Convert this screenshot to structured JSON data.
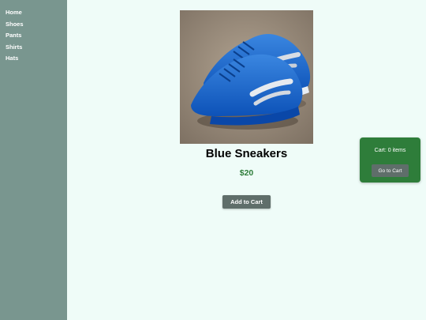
{
  "sidebar": {
    "items": [
      {
        "label": "Home"
      },
      {
        "label": "Shoes"
      },
      {
        "label": "Pants"
      },
      {
        "label": "Shirts"
      },
      {
        "label": "Hats"
      }
    ]
  },
  "product": {
    "title": "Blue Sneakers",
    "price": "$20",
    "add_to_cart_label": "Add to Cart",
    "image_icon": "blue-sneakers-photo"
  },
  "cart": {
    "status": "Cart: 0 items",
    "go_to_cart_label": "Go to Cart"
  },
  "colors": {
    "sidebar_bg": "#79968f",
    "page_bg": "#effcf8",
    "price": "#2e7d3a",
    "cart_bg": "#2e7d3a",
    "button_bg": "#5f6e6a"
  }
}
